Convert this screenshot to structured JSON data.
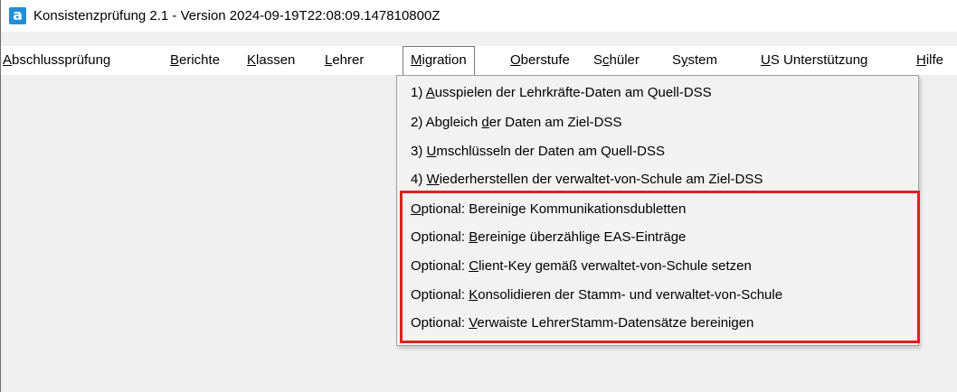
{
  "window": {
    "icon_letter": "a",
    "title": "Konsistenzprüfung 2.1 - Version 2024-09-19T22:08:09.147810800Z"
  },
  "menubar": {
    "items": [
      {
        "pre": "",
        "acc": "A",
        "post": "bschlussprüfung"
      },
      {
        "pre": "",
        "acc": "B",
        "post": "erichte"
      },
      {
        "pre": "",
        "acc": "K",
        "post": "lassen"
      },
      {
        "pre": "",
        "acc": "L",
        "post": "ehrer"
      },
      {
        "pre": "",
        "acc": "M",
        "post": "igration"
      },
      {
        "pre": "",
        "acc": "O",
        "post": "berstufe"
      },
      {
        "pre": "S",
        "acc": "c",
        "post": "hüler"
      },
      {
        "pre": "S",
        "acc": "y",
        "post": "stem"
      },
      {
        "pre": "",
        "acc": "U",
        "post": "S Unterstützung"
      },
      {
        "pre": "",
        "acc": "H",
        "post": "ilfe"
      }
    ],
    "open_item": "Migration"
  },
  "migration_menu": {
    "items": [
      {
        "pre": "1) ",
        "acc": "A",
        "post": "usspielen der Lehrkräfte-Daten am Quell-DSS"
      },
      {
        "pre": "2) Abgleich ",
        "acc": "d",
        "post": "er Daten am Ziel-DSS"
      },
      {
        "pre": "3) ",
        "acc": "U",
        "post": "mschlüsseln der Daten am Quell-DSS"
      },
      {
        "pre": "4) ",
        "acc": "W",
        "post": "iederherstellen der verwaltet-von-Schule am Ziel-DSS"
      },
      {
        "pre": "",
        "acc": "O",
        "post": "ptional: Bereinige Kommunikationsdubletten"
      },
      {
        "pre": "Optional: ",
        "acc": "B",
        "post": "ereinige überzählige EAS-Einträge"
      },
      {
        "pre": "Optional: ",
        "acc": "C",
        "post": "lient-Key gemäß verwaltet-von-Schule setzen"
      },
      {
        "pre": "Optional: ",
        "acc": "K",
        "post": "onsolidieren der Stamm- und verwaltet-von-Schule"
      },
      {
        "pre": "Optional: ",
        "acc": "V",
        "post": "erwaiste LehrerStamm-Datensätze bereinigen"
      }
    ]
  },
  "colors": {
    "highlight_border": "#e0201c",
    "app_icon": "#1f8fd6"
  }
}
